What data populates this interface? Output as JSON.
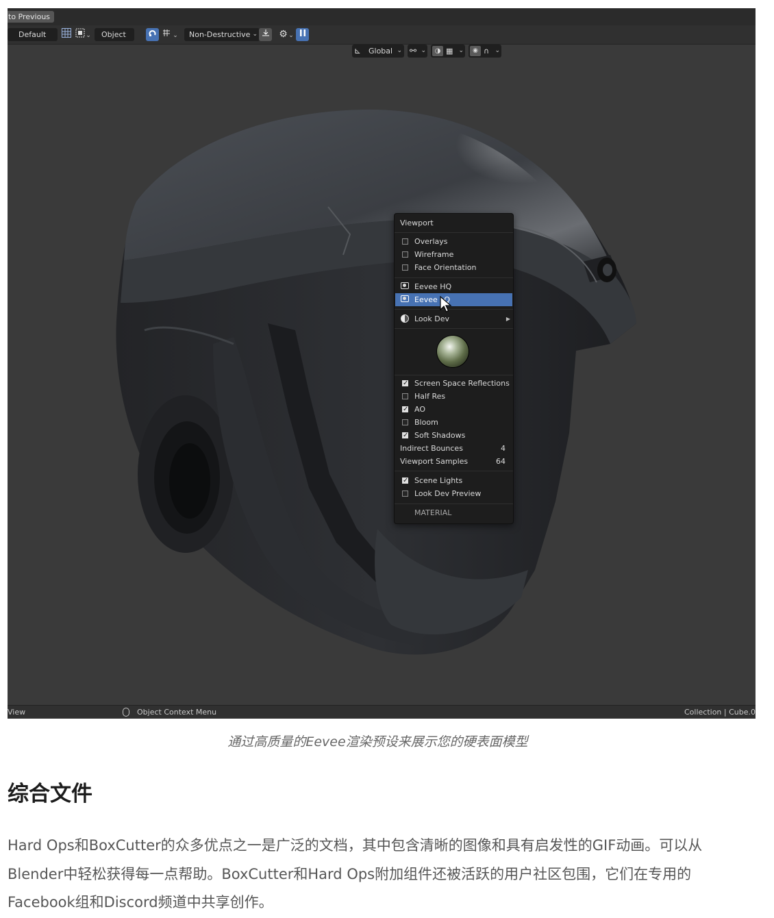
{
  "blender": {
    "top_button": "to Previous",
    "header": {
      "workspace": "Default",
      "mode": "Object",
      "boxcutter_mode": "Non-Destructive"
    },
    "transform": {
      "orientation": "Global"
    },
    "icons": [
      "grid-icon",
      "select-box-icon",
      "snap-icon",
      "settings-gear-icon",
      "pause-icon",
      "pivot-icon",
      "proportional-icon",
      "falloff-icon",
      "mouse-icon"
    ],
    "menu": {
      "title": "Viewport",
      "overlays": {
        "label": "Overlays",
        "checked": false
      },
      "wireframe": {
        "label": "Wireframe",
        "checked": false
      },
      "face_orientation": {
        "label": "Face Orientation",
        "checked": false
      },
      "eevee_hq": "Eevee HQ",
      "eevee_lq": "Eevee LQ",
      "look_dev": "Look Dev",
      "ssr": {
        "label": "Screen Space Reflections",
        "checked": true
      },
      "half_res": {
        "label": "Half Res",
        "checked": false
      },
      "ao": {
        "label": "AO",
        "checked": true
      },
      "bloom": {
        "label": "Bloom",
        "checked": false
      },
      "soft_shadows": {
        "label": "Soft Shadows",
        "checked": true
      },
      "indirect_bounces": {
        "label": "Indirect Bounces",
        "value": "4"
      },
      "viewport_samples": {
        "label": "Viewport Samples",
        "value": "64"
      },
      "scene_lights": {
        "label": "Scene Lights",
        "checked": true
      },
      "look_dev_preview": {
        "label": "Look Dev Preview",
        "checked": false
      },
      "material": "MATERIAL"
    },
    "status": {
      "left": "View",
      "middle": "Object Context Menu",
      "right": "Collection | Cube.0"
    }
  },
  "article": {
    "caption": "通过高质量的Eevee渲染预设来展示您的硬表面模型",
    "heading": "综合文件",
    "paragraph": "Hard Ops和BoxCutter的众多优点之一是广泛的文档，其中包含清晰的图像和具有启发性的GIF动画。可以从Blender中轻松获得每一点帮助。BoxCutter和Hard Ops附加组件还被活跃的用户社区包围，它们在专用的Facebook组和Discord频道中共享创作。"
  },
  "colors": {
    "viewport_bg": "#3a3a3a",
    "menu_bg": "#1d1d1d",
    "highlight": "#4772b3",
    "helmet": "#2a2c2f"
  }
}
